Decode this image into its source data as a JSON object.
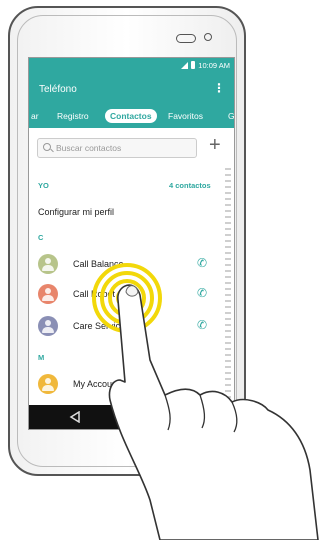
{
  "status": {
    "time": "10:09 AM"
  },
  "appbar": {
    "title": "Teléfono",
    "more_icon": "more-vert-icon"
  },
  "tabs": [
    {
      "label": "ar"
    },
    {
      "label": "Registro"
    },
    {
      "label": "Contactos",
      "active": true
    },
    {
      "label": "Favoritos"
    },
    {
      "label": "G"
    }
  ],
  "search": {
    "placeholder": "Buscar contactos"
  },
  "sections": {
    "yo": "YO",
    "count": "4 contactos",
    "profile": "Configurar mi perfil",
    "c": "C",
    "m": "M"
  },
  "contacts": [
    {
      "name": "Call Balance",
      "color": "#b7c48a"
    },
    {
      "name": "Call Robot",
      "color": "#e8856b"
    },
    {
      "name": "Care Service",
      "color": "#8a8fb5"
    },
    {
      "name": "My Account",
      "color": "#f0b83b"
    }
  ],
  "colors": {
    "accent": "#2fa8a0",
    "tap_ring": "#f2d80a"
  }
}
